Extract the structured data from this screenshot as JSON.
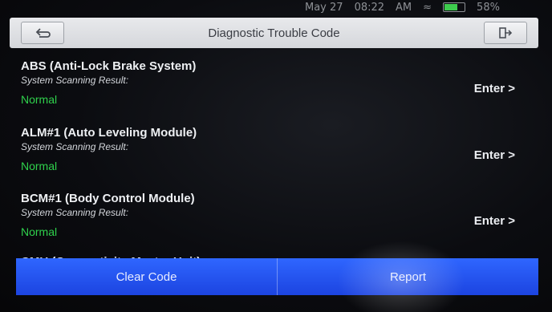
{
  "status": {
    "date": "May 27",
    "time": "08:22",
    "ampm": "AM",
    "battery": "58%"
  },
  "header": {
    "title": "Diagnostic Trouble Code"
  },
  "systems": [
    {
      "name": "ABS (Anti-Lock Brake System)",
      "label": "System Scanning Result:",
      "result": "Normal",
      "enter": "Enter >"
    },
    {
      "name": "ALM#1 (Auto Leveling Module)",
      "label": "System Scanning Result:",
      "result": "Normal",
      "enter": "Enter >"
    },
    {
      "name": "BCM#1 (Body Control Module)",
      "label": "System Scanning Result:",
      "result": "Normal",
      "enter": "Enter >"
    },
    {
      "name": "CMU (Connectivity Master Unit)"
    }
  ],
  "footer": {
    "clear_label": "Clear Code",
    "report_label": "Report"
  },
  "colors": {
    "accent": "#2358f0",
    "normal": "#2fd14c",
    "title_bar": "#dcdee2"
  }
}
